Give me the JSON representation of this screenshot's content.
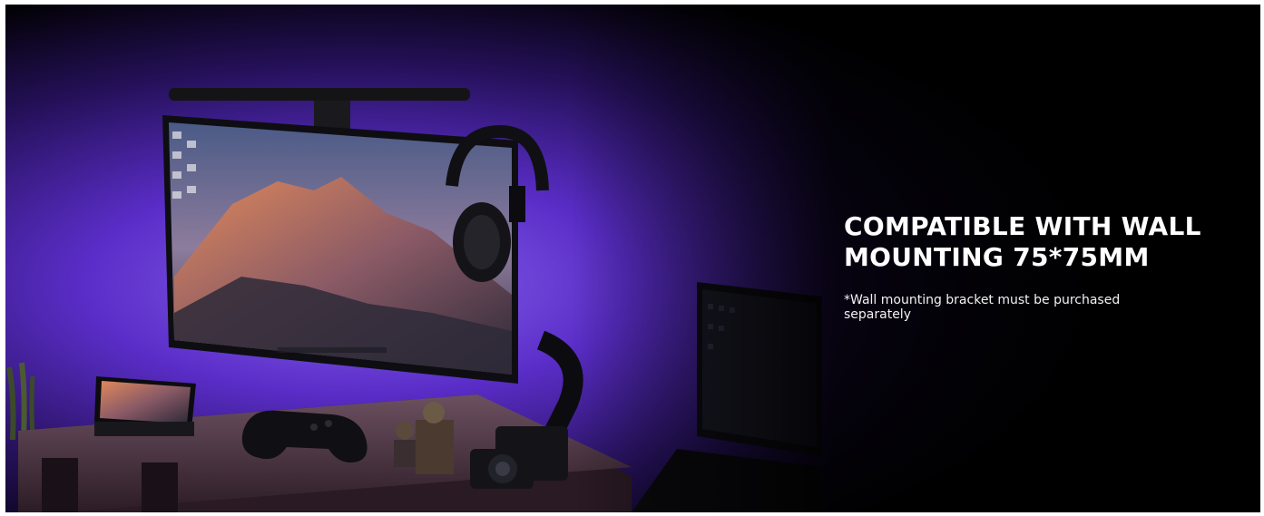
{
  "banner": {
    "headline": "COMPATIBLE WITH WALL MOUNTING 75*75MM",
    "note": "*Wall mounting bracket must be purchased separately"
  },
  "colors": {
    "background": "#000000",
    "accent_purple": "#5a2dc8",
    "wall_glow": "#7c58e6",
    "headline_text": "#ffffff"
  },
  "illustration": {
    "objects": [
      "monitor-light-bar",
      "monitor",
      "headphones",
      "monitor-arm",
      "phone",
      "game-controller",
      "figurines",
      "camera",
      "desk-shelf",
      "laptop",
      "plant"
    ]
  }
}
